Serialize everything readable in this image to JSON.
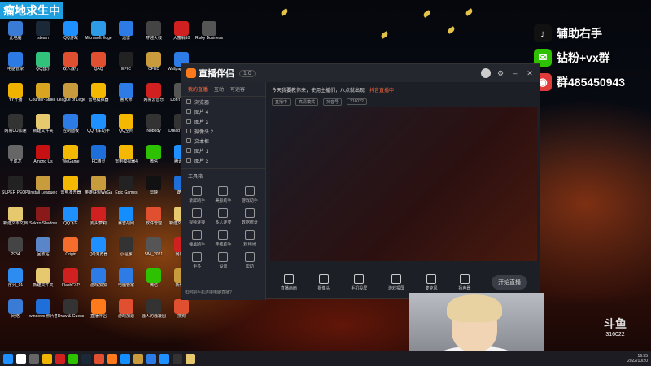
{
  "overlay": {
    "title": "瘤地求生中",
    "promo": [
      {
        "icon": "tiktok-icon",
        "text": "辅助右手",
        "color": "#111111"
      },
      {
        "icon": "wechat-icon",
        "text": "钻粉+vx群",
        "color": "#2dc100"
      },
      {
        "icon": "group-icon",
        "text": "群485450943",
        "color": "#e03a3a"
      }
    ]
  },
  "desktop_icons": [
    {
      "label": "此电脑",
      "color": "#3a7bd5"
    },
    {
      "label": "电脑管家",
      "color": "#2c7be5"
    },
    {
      "label": "YY开播",
      "color": "#f0b400"
    },
    {
      "label": "网易UU加速",
      "color": "#333333"
    },
    {
      "label": "王成龙",
      "color": "#666666"
    },
    {
      "label": "SUPER PEOPLE CBT",
      "color": "#222222"
    },
    {
      "label": "新建文本文档",
      "color": "#e6c86e"
    },
    {
      "label": "2934",
      "color": "#444444"
    },
    {
      "label": "序列_01",
      "color": "#2d8cf0"
    },
    {
      "label": "网络",
      "color": "#3a7bd5"
    },
    {
      "label": "steam",
      "color": "#1b2838"
    },
    {
      "label": "QQ音乐",
      "color": "#31c27c"
    },
    {
      "label": "Counter-Strike Global Off",
      "color": "#d9a520"
    },
    {
      "label": "新建文件夹",
      "color": "#e6c86e"
    },
    {
      "label": "Among Us",
      "color": "#c51111"
    },
    {
      "label": "Install League o",
      "color": "#c89b3c"
    },
    {
      "label": "Sekiro Shadow",
      "color": "#8a1a1a"
    },
    {
      "label": "回收站",
      "color": "#5a86c9"
    },
    {
      "label": "新建文件夹",
      "color": "#e6c86e"
    },
    {
      "label": "windows 照片查看器",
      "color": "#1e6fd9"
    },
    {
      "label": "QQ游戏",
      "color": "#1e90ff"
    },
    {
      "label": "双人成行",
      "color": "#e05030"
    },
    {
      "label": "League of Legends",
      "color": "#c89b3c"
    },
    {
      "label": "控制面板",
      "color": "#2d7be5"
    },
    {
      "label": "WeGame",
      "color": "#f5b800"
    },
    {
      "label": "雷电多开器",
      "color": "#f5b800"
    },
    {
      "label": "QQ飞车",
      "color": "#1e90ff"
    },
    {
      "label": "Origin",
      "color": "#f56c2d"
    },
    {
      "label": "FlashFXP",
      "color": "#d02020"
    },
    {
      "label": "Draw & Guess",
      "color": "#333333"
    },
    {
      "label": "Microsoft Edge",
      "color": "#2d9be5"
    },
    {
      "label": "QAQ",
      "color": "#e05030"
    },
    {
      "label": "雷电模拟器",
      "color": "#f5b800"
    },
    {
      "label": "QQ飞车助手",
      "color": "#1e90ff"
    },
    {
      "label": "FC精灵",
      "color": "#1e6fd9"
    },
    {
      "label": "英雄联盟WeGame版",
      "color": "#c89b3c"
    },
    {
      "label": "狗头萝莉",
      "color": "#d02020"
    },
    {
      "label": "QQ浏览器",
      "color": "#1e90ff"
    },
    {
      "label": "游戏加加",
      "color": "#2d7be5"
    },
    {
      "label": "直播伴侣",
      "color": "#ff7a1a"
    },
    {
      "label": "迅雷",
      "color": "#2d7be5"
    },
    {
      "label": "EPIC",
      "color": "#222222"
    },
    {
      "label": "鲁大师",
      "color": "#2d7be5"
    },
    {
      "label": "QQ空间",
      "color": "#f5b800"
    },
    {
      "label": "雷电模拟器4",
      "color": "#f5b800"
    },
    {
      "label": "Epic Games",
      "color": "#222222"
    },
    {
      "label": "暴雪战网",
      "color": "#148eff"
    },
    {
      "label": "小程序",
      "color": "#333333"
    },
    {
      "label": "电脑管家",
      "color": "#2d7be5"
    },
    {
      "label": "游戏加速",
      "color": "#e05030"
    },
    {
      "label": "穿越火线",
      "color": "#444444"
    },
    {
      "label": "CFHD",
      "color": "#c89b3c"
    },
    {
      "label": "网易云音乐",
      "color": "#d02020"
    },
    {
      "label": "Nobody",
      "color": "#333333"
    },
    {
      "label": "微信",
      "color": "#2dc100"
    },
    {
      "label": "剪映",
      "color": "#111111"
    },
    {
      "label": "软件管理",
      "color": "#e05030"
    },
    {
      "label": "584_2021",
      "color": "#555555"
    },
    {
      "label": "微信",
      "color": "#2dc100"
    },
    {
      "label": "骚人的骚凌图",
      "color": "#333333"
    },
    {
      "label": "大富翁10",
      "color": "#d02020"
    },
    {
      "label": "Wallpaper Engine",
      "color": "#2d7be5"
    },
    {
      "label": "Don't Starve",
      "color": "#555555"
    },
    {
      "label": "Dread Hunger",
      "color": "#333333"
    },
    {
      "label": "腾讯QQ",
      "color": "#1e90ff"
    },
    {
      "label": "酷狗",
      "color": "#1e6fd9"
    },
    {
      "label": "新建文本文档",
      "color": "#e6c86e"
    },
    {
      "label": "网易云",
      "color": "#d02020"
    },
    {
      "label": "新红警",
      "color": "#c89b3c"
    },
    {
      "label": "搜狗",
      "color": "#e05030"
    },
    {
      "label": "Risky Business",
      "color": "#555555"
    }
  ],
  "app": {
    "name": "直播伴侣",
    "version": "1.0",
    "sidebar_tabs": [
      "我的直播",
      "互动",
      "可迷客"
    ],
    "scenes": [
      "浏览器",
      "图片 4",
      "图片 2",
      "摄像头 2",
      "文本框",
      "图片 1",
      "图片 3"
    ],
    "tools_heading": "工具箱",
    "tools": [
      "录屏助手",
      "美颜助手",
      "游戏助手",
      "视频连接",
      "多人连麦",
      "数据统计",
      "弹幕助手",
      "连线助手",
      "粉丝团",
      "更多",
      "设置",
      "帮助"
    ],
    "footer_note": "如何把手机连接电脑直播?",
    "stream_title": "今天我要教你来，使用主播们，八点就出现",
    "stream_highlight": "抖音直播中",
    "info": [
      "直播中",
      "高清模式",
      "抖音号",
      "316022"
    ],
    "bottom_tools": [
      "直播画面",
      "摄像头",
      "手机投屏",
      "游戏投屏",
      "麦克风",
      "扬声器"
    ],
    "go_live": "开始直播"
  },
  "watermark": {
    "line1": "斗鱼",
    "line2": "316022"
  },
  "taskbar": {
    "time": "19:55",
    "date": "2022/10/20"
  }
}
